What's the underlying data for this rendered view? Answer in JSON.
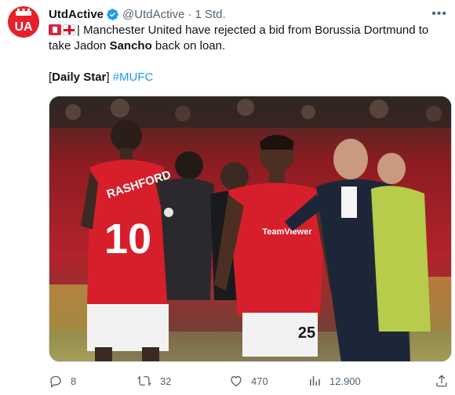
{
  "author": {
    "display_name": "UtdActive",
    "handle": "@UtdActive",
    "separator": "·",
    "time": "1 Std.",
    "avatar_text": "UA",
    "verified": true,
    "avatar_color": "#e8202a"
  },
  "tweet": {
    "line1_prefix": "| Manchester United have rejected a bid from Borussia Dortmund to",
    "line2_pre": "take Jadon ",
    "line2_bold": "Sancho",
    "line2_post": " back on loan.",
    "source_open": "[",
    "source_name": "Daily Star",
    "source_close": "] ",
    "hashtag": "#MUFC"
  },
  "media": {
    "player_name_shirt": "RASHFORD",
    "player_number_left": "10",
    "player_number_right": "25",
    "sponsor": "TeamViewer"
  },
  "actions": {
    "replies": "8",
    "retweets": "32",
    "likes": "470",
    "views": "12.900"
  },
  "colors": {
    "accent": "#1d9bf0",
    "muted": "#536471",
    "verified": "#1d9bf0"
  }
}
